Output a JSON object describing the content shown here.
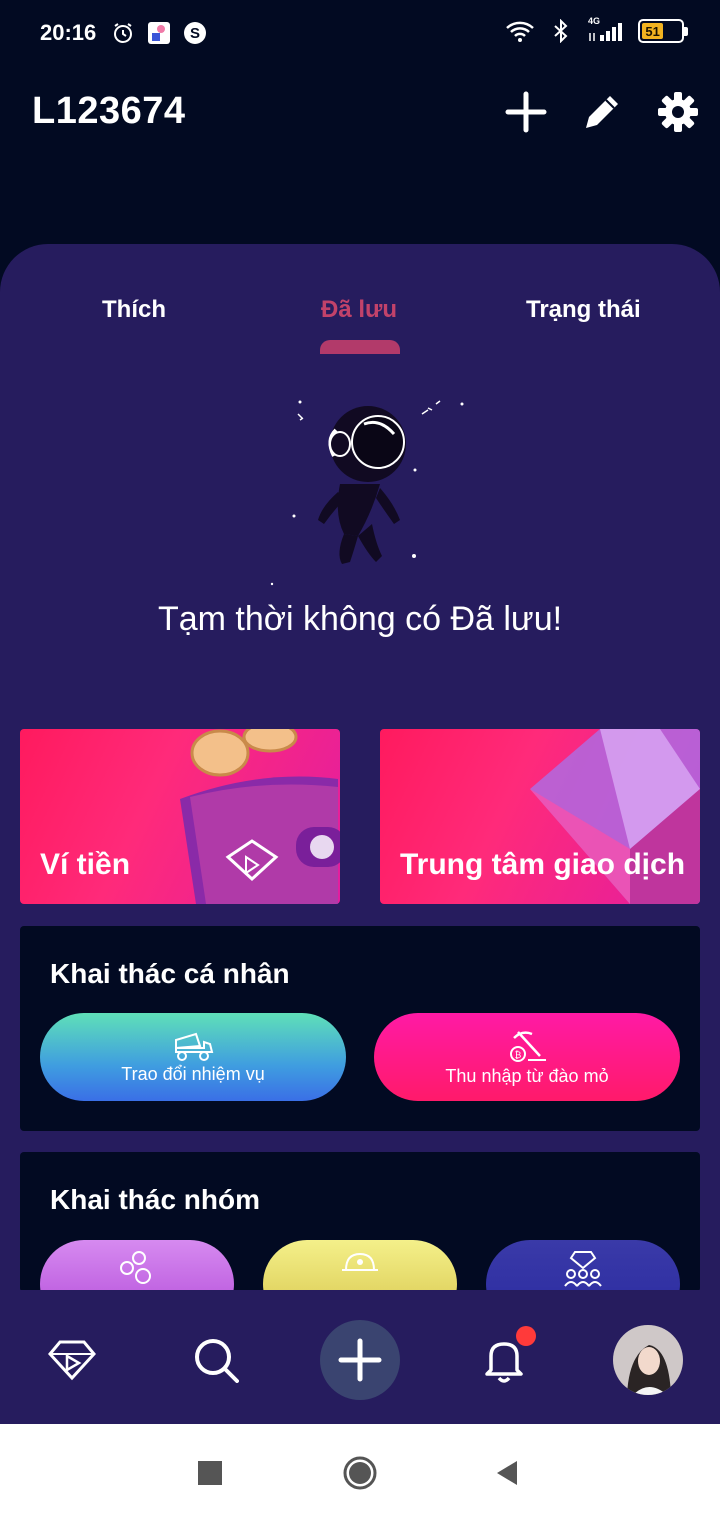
{
  "status_bar": {
    "time": "20:16",
    "left_icons": [
      "alarm-icon",
      "app-notification-icon",
      "s-app-icon"
    ],
    "right_icons": [
      "wifi-icon",
      "bluetooth-icon",
      "signal-4g-icon"
    ],
    "network_label": "4G",
    "battery_level": "51"
  },
  "header": {
    "username": "L123674",
    "actions": [
      "add-icon",
      "edit-icon",
      "settings-icon"
    ]
  },
  "tabs": {
    "items": [
      {
        "label": "Thích",
        "active": false
      },
      {
        "label": "Đã lưu",
        "active": true
      },
      {
        "label": "Trạng thái",
        "active": false
      }
    ],
    "active_color": "#c2426a"
  },
  "empty_state": {
    "message": "Tạm thời không có Đã lưu!",
    "illustration": "astronaut-illustration"
  },
  "promo_cards": {
    "wallet_label": "Ví tiền",
    "exchange_label": "Trung tâm giao dịch"
  },
  "personal_mining": {
    "title": "Khai thác cá nhân",
    "tasks_label": "Trao đổi nhiệm vụ",
    "mining_label": "Thu nhập từ đào mỏ"
  },
  "group_mining": {
    "title": "Khai thác nhóm",
    "buttons": [
      "group-circles-icon",
      "helmet-icon",
      "team-diamond-icon"
    ]
  },
  "bottom_nav": {
    "items": [
      "diamond-home-icon",
      "search-icon",
      "add-icon",
      "bell-icon",
      "avatar"
    ],
    "has_notification": true
  },
  "system_nav": [
    "recent-apps-button",
    "home-button",
    "back-button"
  ],
  "colors": {
    "background": "#020a22",
    "panel": "#261c5e",
    "accent_pink": "#ff1a6a",
    "notification_dot": "#ff3a3a"
  }
}
